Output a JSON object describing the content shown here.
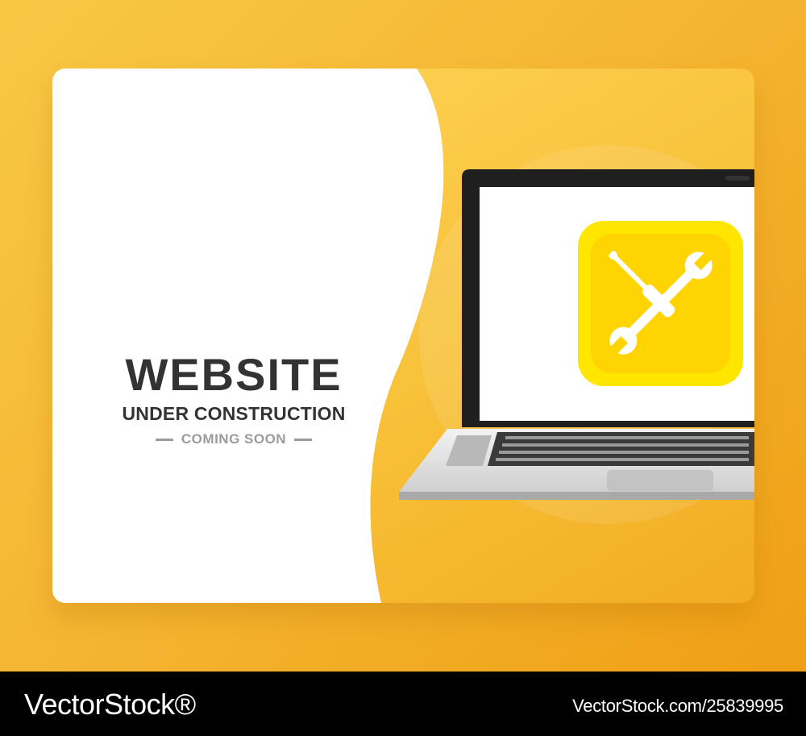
{
  "headline": {
    "title": "WEBSITE",
    "subtitle": "UNDER CONSTRUCTION",
    "tagline": "COMING SOON"
  },
  "footer": {
    "brand": "VectorStock®",
    "image_id": "VectorStock.com/25839995"
  },
  "colors": {
    "accent": "#f5b733",
    "dark_text": "#333333",
    "gray_text": "#9b9b9b",
    "icon_tile": "#ffd800"
  },
  "icons": {
    "laptop": "laptop-icon",
    "tools": "screwdriver-wrench-icon"
  }
}
